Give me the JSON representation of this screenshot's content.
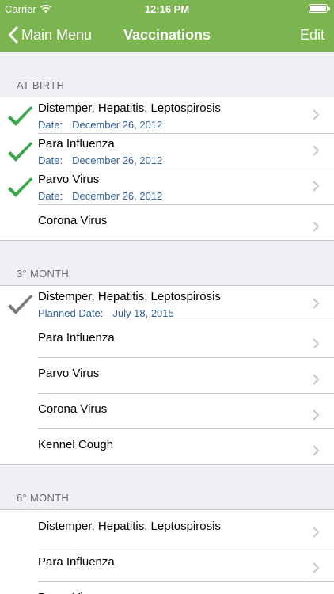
{
  "status": {
    "carrier": "Carrier",
    "time": "12:16 PM"
  },
  "nav": {
    "back_label": "Main Menu",
    "title": "Vaccinations",
    "edit_label": "Edit"
  },
  "colors": {
    "bar": "#7cb450",
    "check_done": "#3aa84a",
    "check_planned": "#7b7b7b",
    "date_text": "#33619a"
  },
  "sections": [
    {
      "header": "AT BIRTH",
      "rows": [
        {
          "name": "Distemper, Hepatitis, Leptospirosis",
          "date_label": "Date:",
          "date": "December 26, 2012",
          "check": "done"
        },
        {
          "name": "Para Influenza",
          "date_label": "Date:",
          "date": "December 26, 2012",
          "check": "done"
        },
        {
          "name": "Parvo Virus",
          "date_label": "Date:",
          "date": "December 26, 2012",
          "check": "done"
        },
        {
          "name": "Corona Virus"
        }
      ]
    },
    {
      "header": "3° MONTH",
      "rows": [
        {
          "name": "Distemper, Hepatitis, Leptospirosis",
          "date_label": "Planned Date:",
          "date": "July 18, 2015",
          "check": "planned"
        },
        {
          "name": "Para Influenza"
        },
        {
          "name": "Parvo Virus"
        },
        {
          "name": "Corona Virus"
        },
        {
          "name": "Kennel Cough"
        }
      ]
    },
    {
      "header": "6° MONTH",
      "rows": [
        {
          "name": "Distemper, Hepatitis, Leptospirosis"
        },
        {
          "name": "Para Influenza"
        },
        {
          "name": "Parvo Virus"
        }
      ]
    }
  ]
}
